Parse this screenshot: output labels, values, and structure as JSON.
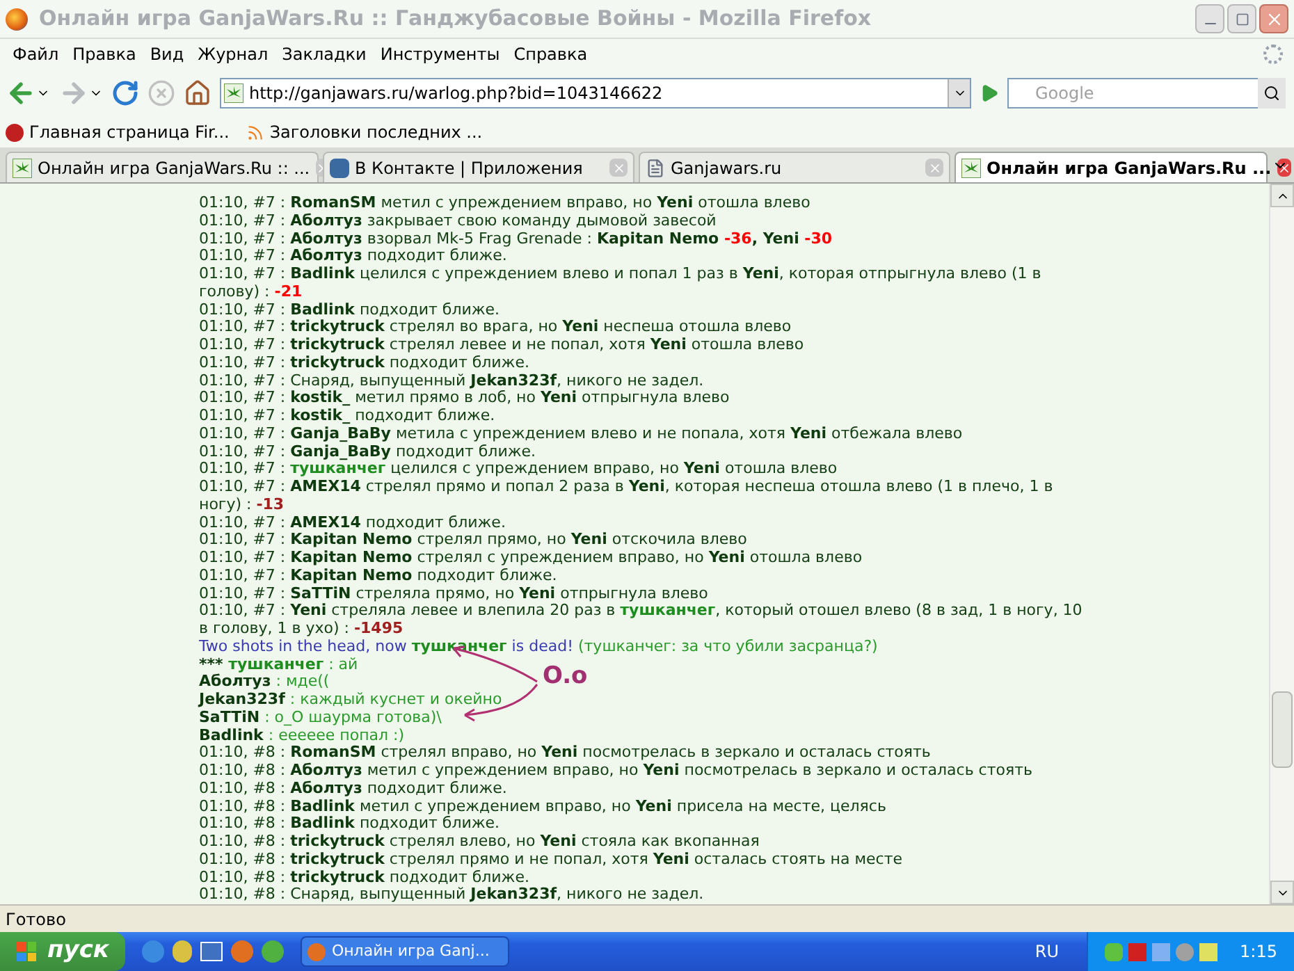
{
  "window": {
    "title": "Онлайн игра GanjaWars.Ru :: Ганджубасовые Войны - Mozilla Firefox"
  },
  "menu": [
    "Файл",
    "Правка",
    "Вид",
    "Журнал",
    "Закладки",
    "Инструменты",
    "Справка"
  ],
  "address": {
    "value": "http://ganjawars.ru/warlog.php?bid=1043146622"
  },
  "search": {
    "placeholder": "Google"
  },
  "bookmarks": [
    {
      "label": "Главная страница Fir...",
      "kind": "page"
    },
    {
      "label": "Заголовки последних ...",
      "kind": "feed"
    }
  ],
  "tabs": [
    {
      "label": "Онлайн игра GanjaWars.Ru :: ...",
      "kind": "leaf",
      "selected": false
    },
    {
      "label": "В Контакте | Приложения",
      "kind": "vk",
      "selected": false
    },
    {
      "label": "Ganjawars.ru",
      "kind": "page",
      "selected": false
    },
    {
      "label": "Онлайн игра GanjaWars.Ru ...",
      "kind": "leaf",
      "selected": true
    }
  ],
  "log": {
    "lines": [
      {
        "parts": [
          {
            "kind": "plain",
            "text": "01:10, #7 : "
          },
          {
            "kind": "name",
            "text": "RomanSM"
          },
          {
            "kind": "plain",
            "text": " метил с упреждением вправо, но "
          },
          {
            "kind": "name",
            "text": "Yeni"
          },
          {
            "kind": "plain",
            "text": " отошла влево"
          }
        ]
      },
      {
        "parts": [
          {
            "kind": "plain",
            "text": "01:10, #7 : "
          },
          {
            "kind": "name",
            "text": "Аболтуз"
          },
          {
            "kind": "plain",
            "text": " закрывает свою команду дымовой завесой"
          }
        ]
      },
      {
        "parts": [
          {
            "kind": "plain",
            "text": "01:10, #7 : "
          },
          {
            "kind": "name",
            "text": "Аболтуз"
          },
          {
            "kind": "plain",
            "text": " взорвал Mk-5 Frag Grenade : "
          },
          {
            "kind": "name",
            "text": "Kapitan Nemo"
          },
          {
            "kind": "damage",
            "text": " -36",
            "color": "#ff0000"
          },
          {
            "kind": "name",
            "text": ", Yeni"
          },
          {
            "kind": "damage",
            "text": " -30",
            "color": "#ff0000"
          }
        ]
      },
      {
        "parts": [
          {
            "kind": "plain",
            "text": "01:10, #7 : "
          },
          {
            "kind": "name",
            "text": "Аболтуз"
          },
          {
            "kind": "plain",
            "text": " подходит ближе."
          }
        ]
      },
      {
        "parts": [
          {
            "kind": "plain",
            "text": "01:10, #7 : "
          },
          {
            "kind": "name",
            "text": "Badlink"
          },
          {
            "kind": "plain",
            "text": " целился с упреждением влево и попал 1 раз в "
          },
          {
            "kind": "name",
            "text": "Yeni"
          },
          {
            "kind": "plain",
            "text": ", которая отпрыгнула влево (1 в голову) : "
          },
          {
            "kind": "damage",
            "text": "-21",
            "color": "#ff0000"
          }
        ]
      },
      {
        "parts": [
          {
            "kind": "plain",
            "text": "01:10, #7 : "
          },
          {
            "kind": "name",
            "text": "Badlink"
          },
          {
            "kind": "plain",
            "text": " подходит ближе."
          }
        ]
      },
      {
        "parts": [
          {
            "kind": "plain",
            "text": "01:10, #7 : "
          },
          {
            "kind": "name",
            "text": "trickytruck"
          },
          {
            "kind": "plain",
            "text": " стрелял во врага, но "
          },
          {
            "kind": "name",
            "text": "Yeni"
          },
          {
            "kind": "plain",
            "text": " неспеша отошла влево"
          }
        ]
      },
      {
        "parts": [
          {
            "kind": "plain",
            "text": "01:10, #7 : "
          },
          {
            "kind": "name",
            "text": "trickytruck"
          },
          {
            "kind": "plain",
            "text": " стрелял левее и не попал, хотя "
          },
          {
            "kind": "name",
            "text": "Yeni"
          },
          {
            "kind": "plain",
            "text": " отошла влево"
          }
        ]
      },
      {
        "parts": [
          {
            "kind": "plain",
            "text": "01:10, #7 : "
          },
          {
            "kind": "name",
            "text": "trickytruck"
          },
          {
            "kind": "plain",
            "text": " подходит ближе."
          }
        ]
      },
      {
        "parts": [
          {
            "kind": "plain",
            "text": "01:10, #7 : Снаряд, выпущенный "
          },
          {
            "kind": "name",
            "text": "Jekan323f"
          },
          {
            "kind": "plain",
            "text": ", никого не задел."
          }
        ]
      },
      {
        "parts": [
          {
            "kind": "plain",
            "text": "01:10, #7 : "
          },
          {
            "kind": "name",
            "text": "kostik_"
          },
          {
            "kind": "plain",
            "text": " метил прямо в лоб, но "
          },
          {
            "kind": "name",
            "text": "Yeni"
          },
          {
            "kind": "plain",
            "text": " отпрыгнула влево"
          }
        ]
      },
      {
        "parts": [
          {
            "kind": "plain",
            "text": "01:10, #7 : "
          },
          {
            "kind": "name",
            "text": "kostik_"
          },
          {
            "kind": "plain",
            "text": " подходит ближе."
          }
        ]
      },
      {
        "parts": [
          {
            "kind": "plain",
            "text": "01:10, #7 : "
          },
          {
            "kind": "name",
            "text": "Ganja_BaBy"
          },
          {
            "kind": "plain",
            "text": " метила с упреждением влево и не попала, хотя "
          },
          {
            "kind": "name",
            "text": "Yeni"
          },
          {
            "kind": "plain",
            "text": " отбежала влево"
          }
        ]
      },
      {
        "parts": [
          {
            "kind": "plain",
            "text": "01:10, #7 : "
          },
          {
            "kind": "name",
            "text": "Ganja_BaBy"
          },
          {
            "kind": "plain",
            "text": " подходит ближе."
          }
        ]
      },
      {
        "parts": [
          {
            "kind": "plain",
            "text": "01:10, #7 : "
          },
          {
            "kind": "ally",
            "text": "тушканчег"
          },
          {
            "kind": "plain",
            "text": " целился с упреждением вправо, но "
          },
          {
            "kind": "name",
            "text": "Yeni"
          },
          {
            "kind": "plain",
            "text": " отошла влево"
          }
        ]
      },
      {
        "parts": [
          {
            "kind": "plain",
            "text": "01:10, #7 : "
          },
          {
            "kind": "name",
            "text": "AMEX14"
          },
          {
            "kind": "plain",
            "text": " стрелял прямо и попал 2 раза в "
          },
          {
            "kind": "name",
            "text": "Yeni"
          },
          {
            "kind": "plain",
            "text": ", которая неспеша отошла влево (1 в плечо, 1 в ногу) : "
          },
          {
            "kind": "damage",
            "text": "-13",
            "color": "#a02020"
          }
        ]
      },
      {
        "parts": [
          {
            "kind": "plain",
            "text": "01:10, #7 : "
          },
          {
            "kind": "name",
            "text": "AMEX14"
          },
          {
            "kind": "plain",
            "text": " подходит ближе."
          }
        ]
      },
      {
        "parts": [
          {
            "kind": "plain",
            "text": "01:10, #7 : "
          },
          {
            "kind": "name",
            "text": "Kapitan Nemo"
          },
          {
            "kind": "plain",
            "text": " стрелял прямо, но "
          },
          {
            "kind": "name",
            "text": "Yeni"
          },
          {
            "kind": "plain",
            "text": " отскочила влево"
          }
        ]
      },
      {
        "parts": [
          {
            "kind": "plain",
            "text": "01:10, #7 : "
          },
          {
            "kind": "name",
            "text": "Kapitan Nemo"
          },
          {
            "kind": "plain",
            "text": " стрелял с упреждением вправо, но "
          },
          {
            "kind": "name",
            "text": "Yeni"
          },
          {
            "kind": "plain",
            "text": " отошла влево"
          }
        ]
      },
      {
        "parts": [
          {
            "kind": "plain",
            "text": "01:10, #7 : "
          },
          {
            "kind": "name",
            "text": "Kapitan Nemo"
          },
          {
            "kind": "plain",
            "text": " подходит ближе."
          }
        ]
      },
      {
        "parts": [
          {
            "kind": "plain",
            "text": "01:10, #7 : "
          },
          {
            "kind": "name",
            "text": "SaTTiN"
          },
          {
            "kind": "plain",
            "text": " стреляла прямо, но "
          },
          {
            "kind": "name",
            "text": "Yeni"
          },
          {
            "kind": "plain",
            "text": " отпрыгнула влево"
          }
        ]
      },
      {
        "parts": [
          {
            "kind": "plain",
            "text": "01:10, #7 : "
          },
          {
            "kind": "name",
            "text": "Yeni"
          },
          {
            "kind": "plain",
            "text": " стреляла левее и влепила 20 раз в "
          },
          {
            "kind": "ally",
            "text": "тушканчег"
          },
          {
            "kind": "plain",
            "text": ", который отошел влево (8 в зад, 1 в ногу, 10 в голову, 1 в ухо) : "
          },
          {
            "kind": "damage",
            "text": "-1495",
            "color": "#a02020"
          }
        ]
      },
      {
        "parts": [
          {
            "kind": "info",
            "text": "Two shots in the head, now "
          },
          {
            "kind": "ally",
            "text": "тушканчег"
          },
          {
            "kind": "info",
            "text": " is dead! "
          },
          {
            "kind": "chat",
            "text": "(тушканчег: за что убили засранца?)"
          }
        ]
      },
      {
        "parts": [
          {
            "kind": "name",
            "text": "*** "
          },
          {
            "kind": "ally",
            "text": "тушканчег"
          },
          {
            "kind": "chat",
            "text": " : ай"
          }
        ]
      },
      {
        "parts": [
          {
            "kind": "name",
            "text": "Аболтуз"
          },
          {
            "kind": "chat",
            "text": " : мде(("
          }
        ]
      },
      {
        "parts": [
          {
            "kind": "name",
            "text": "Jekan323f"
          },
          {
            "kind": "chat",
            "text": " : каждый куснет и окейно"
          }
        ]
      },
      {
        "parts": [
          {
            "kind": "name",
            "text": "SaTTiN"
          },
          {
            "kind": "chat",
            "text": " : о_О шаурма готова)\\"
          }
        ]
      },
      {
        "parts": [
          {
            "kind": "name",
            "text": "Badlink"
          },
          {
            "kind": "chat",
            "text": " : ееееее попал :)"
          }
        ]
      },
      {
        "parts": [
          {
            "kind": "plain",
            "text": "01:10, #8 : "
          },
          {
            "kind": "name",
            "text": "RomanSM"
          },
          {
            "kind": "plain",
            "text": " стрелял вправо, но "
          },
          {
            "kind": "name",
            "text": "Yeni"
          },
          {
            "kind": "plain",
            "text": " посмотрелась в зеркало и осталась стоять"
          }
        ]
      },
      {
        "parts": [
          {
            "kind": "plain",
            "text": "01:10, #8 : "
          },
          {
            "kind": "name",
            "text": "Аболтуз"
          },
          {
            "kind": "plain",
            "text": " метил с упреждением вправо, но "
          },
          {
            "kind": "name",
            "text": "Yeni"
          },
          {
            "kind": "plain",
            "text": " посмотрелась в зеркало и осталась стоять"
          }
        ]
      },
      {
        "parts": [
          {
            "kind": "plain",
            "text": "01:10, #8 : "
          },
          {
            "kind": "name",
            "text": "Аболтуз"
          },
          {
            "kind": "plain",
            "text": " подходит ближе."
          }
        ]
      },
      {
        "parts": [
          {
            "kind": "plain",
            "text": "01:10, #8 : "
          },
          {
            "kind": "name",
            "text": "Badlink"
          },
          {
            "kind": "plain",
            "text": " метил с упреждением вправо, но "
          },
          {
            "kind": "name",
            "text": "Yeni"
          },
          {
            "kind": "plain",
            "text": " присела на месте, целясь"
          }
        ]
      },
      {
        "parts": [
          {
            "kind": "plain",
            "text": "01:10, #8 : "
          },
          {
            "kind": "name",
            "text": "Badlink"
          },
          {
            "kind": "plain",
            "text": " подходит ближе."
          }
        ]
      },
      {
        "parts": [
          {
            "kind": "plain",
            "text": "01:10, #8 : "
          },
          {
            "kind": "name",
            "text": "trickytruck"
          },
          {
            "kind": "plain",
            "text": " стрелял влево, но "
          },
          {
            "kind": "name",
            "text": "Yeni"
          },
          {
            "kind": "plain",
            "text": " стояла как вкопанная"
          }
        ]
      },
      {
        "parts": [
          {
            "kind": "plain",
            "text": "01:10, #8 : "
          },
          {
            "kind": "name",
            "text": "trickytruck"
          },
          {
            "kind": "plain",
            "text": " стрелял прямо и не попал, хотя "
          },
          {
            "kind": "name",
            "text": "Yeni"
          },
          {
            "kind": "plain",
            "text": " осталась стоять на месте"
          }
        ]
      },
      {
        "parts": [
          {
            "kind": "plain",
            "text": "01:10, #8 : "
          },
          {
            "kind": "name",
            "text": "trickytruck"
          },
          {
            "kind": "plain",
            "text": " подходит ближе."
          }
        ]
      },
      {
        "parts": [
          {
            "kind": "plain",
            "text": "01:10, #8 : Снаряд, выпущенный "
          },
          {
            "kind": "name",
            "text": "Jekan323f"
          },
          {
            "kind": "plain",
            "text": ", никого не задел."
          }
        ]
      }
    ],
    "annotation": "O.o"
  },
  "status_bar": "Готово",
  "taskbar": {
    "start": "пуск",
    "tasks": [
      {
        "label": "Онлайн игра Ganj..."
      }
    ],
    "language": "RU",
    "clock": "1:15"
  }
}
